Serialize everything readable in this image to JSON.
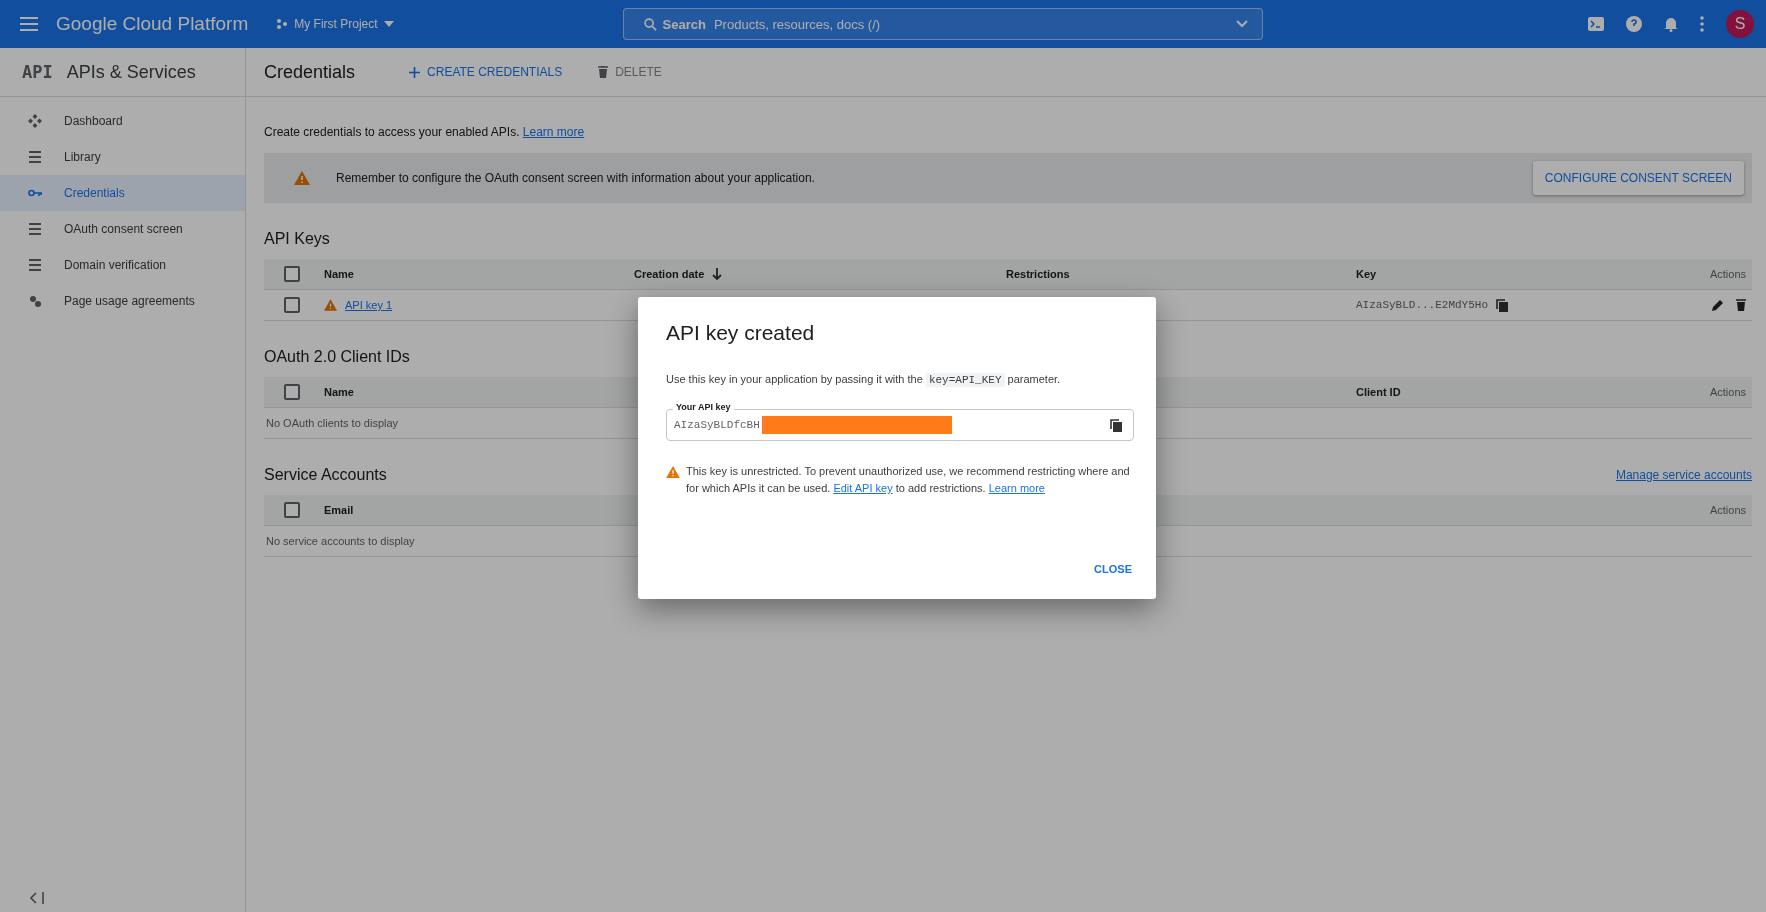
{
  "topbar": {
    "product": "Google Cloud Platform",
    "project": "My First Project",
    "search": {
      "label": "Search",
      "placeholder": "Products, resources, docs (/)"
    },
    "avatar": "S"
  },
  "sidebar": {
    "logo": "API",
    "title": "APIs & Services",
    "items": [
      {
        "label": "Dashboard",
        "selected": false
      },
      {
        "label": "Library",
        "selected": false
      },
      {
        "label": "Credentials",
        "selected": true
      },
      {
        "label": "OAuth consent screen",
        "selected": false
      },
      {
        "label": "Domain verification",
        "selected": false
      },
      {
        "label": "Page usage agreements",
        "selected": false
      }
    ]
  },
  "header": {
    "title": "Credentials",
    "actions": [
      {
        "label": "CREATE CREDENTIALS",
        "kind": "create"
      },
      {
        "label": "DELETE",
        "kind": "delete"
      }
    ]
  },
  "intro": {
    "text": "Create credentials to access your enabled APIs.",
    "link": "Learn more"
  },
  "banner": {
    "text": "Remember to configure the OAuth consent screen with information about your application.",
    "button": "CONFIGURE CONSENT SCREEN"
  },
  "sections": [
    {
      "title": "API Keys",
      "columns": [
        {
          "label": "Name",
          "sorted": false
        },
        {
          "label": "Creation date",
          "sorted": true
        },
        {
          "label": "Restrictions",
          "sorted": false
        },
        {
          "label": "Key",
          "sorted": false
        },
        {
          "label": "Actions",
          "sorted": false
        }
      ],
      "header_checked": false,
      "rows": [
        {
          "checked": false,
          "warning": true,
          "name": "API key 1",
          "key": "AIzaSyBLD...E2MdY5Ho"
        }
      ]
    },
    {
      "title": "OAuth 2.0 Client IDs",
      "columns": [
        {
          "label": "Name",
          "sorted": false
        },
        {},
        {},
        {
          "label": "Client ID",
          "sorted": false
        },
        {
          "label": "Actions",
          "sorted": false
        }
      ],
      "header_checked": false,
      "empty": "No OAuth clients to display"
    },
    {
      "title": "Service Accounts",
      "link": "Manage service accounts",
      "columns": [
        {
          "label": "Email",
          "sorted": false
        },
        {},
        {},
        {},
        {
          "label": "Actions",
          "sorted": false
        }
      ],
      "header_checked": false,
      "empty": "No service accounts to display"
    }
  ],
  "dialog": {
    "title": "API key created",
    "intro": [
      {
        "kind": "text",
        "text": "Use this key in your application by passing it with the"
      },
      {
        "kind": "code",
        "text": "key=API_KEY"
      },
      {
        "kind": "text",
        "text": "parameter."
      }
    ],
    "field": {
      "label": "Your API key",
      "value": "AIzaSyBLDfcBH",
      "redacted": true
    },
    "warning": [
      {
        "kind": "text",
        "text": "This key is unrestricted. To prevent unauthorized use, we recommend restricting where and for which APIs it can be used."
      },
      {
        "kind": "link",
        "text": "Edit API key"
      },
      {
        "kind": "text",
        "text": "to add restrictions."
      },
      {
        "kind": "link",
        "text": "Learn more"
      }
    ],
    "button": "CLOSE"
  }
}
